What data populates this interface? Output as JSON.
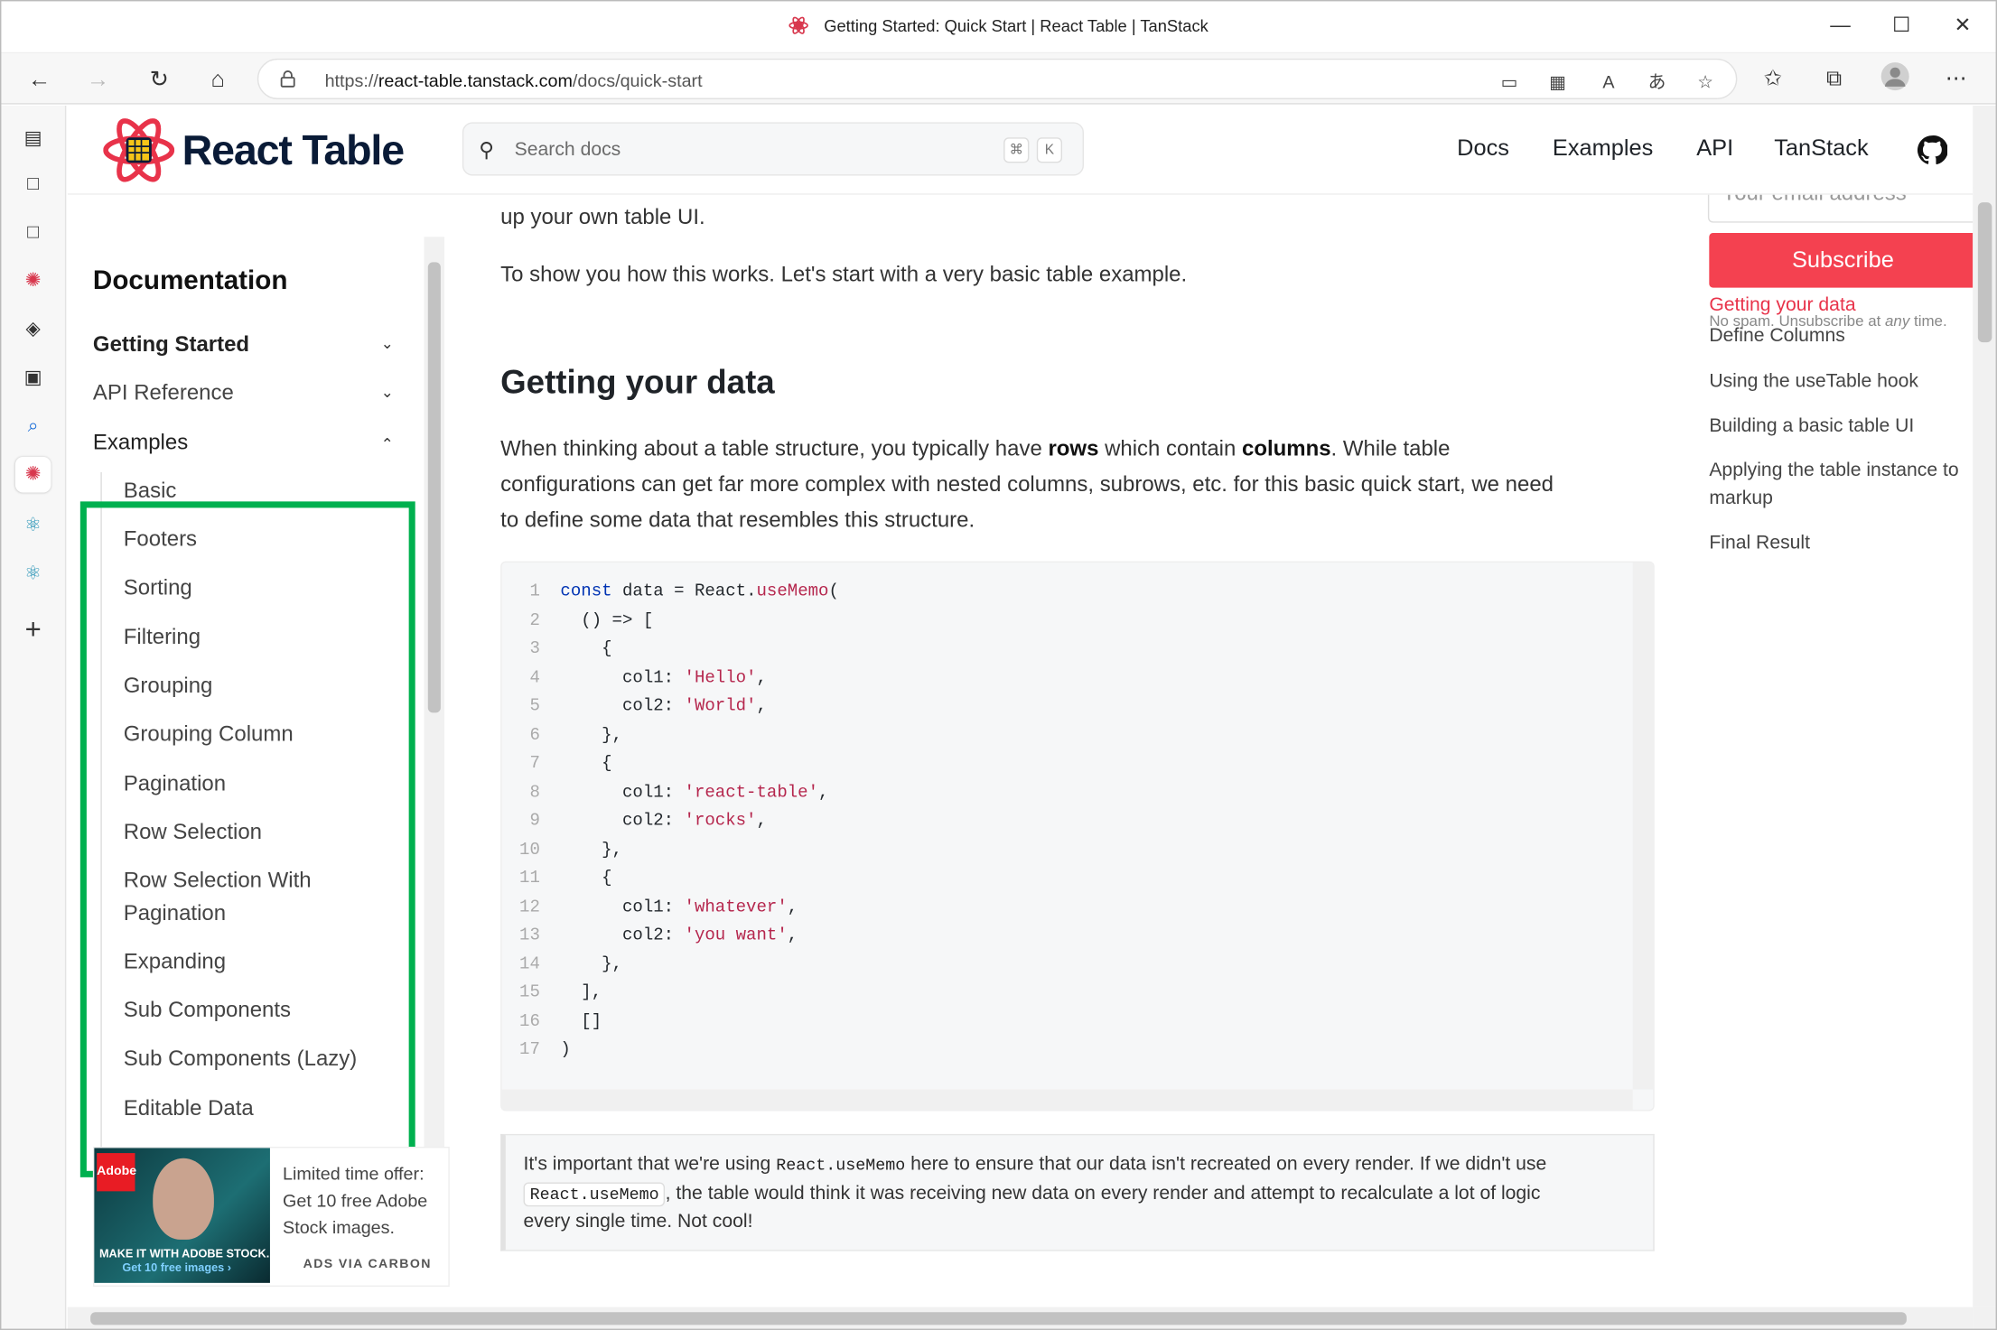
{
  "window": {
    "title": "Getting Started: Quick Start | React Table | TanStack",
    "minimize": "—",
    "maximize": "☐",
    "close": "✕"
  },
  "browser": {
    "url_prefix": "https://",
    "url_host": "react-table.tanstack.com",
    "url_path": "/docs/quick-start",
    "back_icon": "←",
    "forward_icon": "→",
    "refresh_icon": "↻",
    "home_icon": "⌂",
    "menu_icon": "⋯"
  },
  "header": {
    "logo_text": "React Table",
    "search_placeholder": "Search docs",
    "search_kbd_1": "⌘",
    "search_kbd_2": "K",
    "nav": [
      "Docs",
      "Examples",
      "API",
      "TanStack"
    ]
  },
  "sidebar": {
    "heading": "Documentation",
    "sections": [
      {
        "label": "Getting Started"
      },
      {
        "label": "API Reference"
      },
      {
        "label": "Examples"
      }
    ],
    "items": [
      "Basic",
      "Footers",
      "Sorting",
      "Filtering",
      "Grouping",
      "Grouping Column",
      "Pagination",
      "Row Selection",
      "Row Selection With",
      "Pagination",
      "Expanding",
      "Sub Components",
      "Sub Components (Lazy)",
      "Editable Data"
    ],
    "ad": {
      "offer_line1": "Limited time offer:",
      "offer_line2": "Get 10 free Adobe",
      "offer_line3": "Stock images.",
      "via": "ADS VIA CARBON",
      "img_caption": "MAKE IT WITH ADOBE STOCK.",
      "img_caption2": "Get 10 free images ›",
      "img_logo": "Adobe"
    }
  },
  "main": {
    "intro_tail": "up your own table UI.",
    "intro2": "To show you how this works. Let's start with a very basic table example.",
    "heading": "Getting your data",
    "para_1a": "When thinking about a table structure, you typically have ",
    "para_1b": "rows",
    "para_1c": " which contain ",
    "para_1d": "columns",
    "para_1e": ". While table",
    "para_2": "configurations can get far more complex with nested columns, subrows, etc. for this basic quick start, we need",
    "para_3": "to define some data that resembles this structure.",
    "code_lines": [
      "1",
      "2",
      "3",
      "4",
      "5",
      "6",
      "7",
      "8",
      "9",
      "10",
      "11",
      "12",
      "13",
      "14",
      "15",
      "16",
      "17"
    ],
    "code": {
      "l1_kw": "const",
      "l1_a": " data = React.",
      "l1_fn": "useMemo",
      "l1_b": "(",
      "l2": "  () => [",
      "l3": "    {",
      "l4_a": "      col1: ",
      "l4_s": "'Hello'",
      "l4_b": ",",
      "l5_a": "      col2: ",
      "l5_s": "'World'",
      "l5_b": ",",
      "l6": "    },",
      "l7": "    {",
      "l8_a": "      col1: ",
      "l8_s": "'react-table'",
      "l8_b": ",",
      "l9_a": "      col2: ",
      "l9_s": "'rocks'",
      "l9_b": ",",
      "l10": "    },",
      "l11": "    {",
      "l12_a": "      col1: ",
      "l12_s": "'whatever'",
      "l12_b": ",",
      "l13_a": "      col2: ",
      "l13_s": "'you want'",
      "l13_b": ",",
      "l14": "    },",
      "l15": "  ],",
      "l16": "  []",
      "l17": ")"
    },
    "note_a": "It's important that we're using ",
    "note_code1": "React.useMemo",
    "note_b": " here to ensure that our data isn't recreated on every render. If we didn't use",
    "note_code2": "React.useMemo",
    "note_c": ", the table would think it was receiving new data on every render and attempt to recalculate a lot of logic",
    "note_d": "every single time. Not cool!"
  },
  "toc": {
    "email_placeholder": "Your email address",
    "subscribe": "Subscribe",
    "nospam_a": "No spam. Unsubscribe at ",
    "nospam_b": "any",
    "nospam_c": " time.",
    "items": [
      "Getting your data",
      "Define Columns",
      "Using the useTable hook",
      "Building a basic table UI",
      "Applying the table instance to markup",
      "Final Result"
    ]
  },
  "colors": {
    "highlight": "#00b04f",
    "subscribe": "#f44150",
    "toc_active": "#e8334a"
  }
}
